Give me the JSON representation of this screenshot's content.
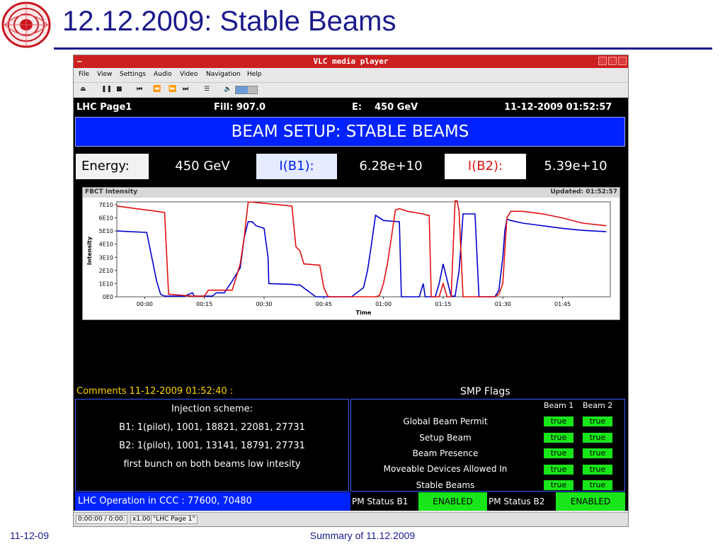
{
  "slide": {
    "title": "12.12.2009: Stable Beams",
    "footer_date": "11-12-09",
    "footer_center": "Summary of 11.12.2009"
  },
  "vlc": {
    "title": "VLC media player",
    "menu": [
      "File",
      "View",
      "Settings",
      "Audio",
      "Video",
      "Navigation",
      "Help"
    ],
    "toolbar_icons": [
      "eject-icon",
      "pause-icon",
      "stop-icon",
      "skip-back-icon",
      "rewind-icon",
      "fast-forward-icon",
      "skip-forward-icon",
      "playlist-icon",
      "volume-icon"
    ],
    "volume_level": 0.55,
    "status": {
      "time": "0:00:00 / 0:00:",
      "speed": "x1.00",
      "media": "\"LHC Page 1\""
    }
  },
  "lhc": {
    "page": "LHC Page1",
    "fill": "Fill: 907.0",
    "energy_label": "E:",
    "energy_value": "450 GeV",
    "datetime": "11-12-2009 01:52:57",
    "banner": "BEAM SETUP: STABLE BEAMS",
    "values": {
      "energy_label": "Energy:",
      "energy": "450 GeV",
      "ib1_label": "I(B1):",
      "ib1": "6.28e+10",
      "ib2_label": "I(B2):",
      "ib2": "5.39e+10"
    },
    "comments_label": "Comments 11-12-2009 01:52:40 :",
    "comments": [
      "Injection scheme:",
      "B1: 1(pilot), 1001, 18821, 22081, 27731",
      "B2: 1(pilot), 1001, 13141, 18791, 27731",
      "first bunch on both beams low intesity"
    ],
    "smp_label": "SMP Flags",
    "smp_columns": [
      "Beam 1",
      "Beam 2"
    ],
    "smp_flags": [
      {
        "name": "Global Beam Permit",
        "b1": "true",
        "b2": "true"
      },
      {
        "name": "Setup Beam",
        "b1": "true",
        "b2": "true"
      },
      {
        "name": "Beam Presence",
        "b1": "true",
        "b2": "true"
      },
      {
        "name": "Moveable Devices Allowed In",
        "b1": "true",
        "b2": "true"
      },
      {
        "name": "Stable Beams",
        "b1": "true",
        "b2": "true"
      }
    ],
    "operations": "LHC Operation in CCC : 77600, 70480",
    "pm_b1_label": "PM Status B1",
    "pm_b1": "ENABLED",
    "pm_b2_label": "PM Status B2",
    "pm_b2": "ENABLED",
    "colors": {
      "b1": "#0000cc",
      "b2": "#e01010",
      "banner": "#0022ff",
      "flag": "#19e619"
    }
  },
  "chart_data": {
    "type": "line",
    "title": "FBCT Intensity",
    "updated": "Updated: 01:52:57",
    "xlabel": "Time",
    "ylabel": "Intensity",
    "x_ticks": [
      "00:00",
      "00:15",
      "00:30",
      "00:45",
      "01:00",
      "01:15",
      "01:30",
      "01:45"
    ],
    "y_ticks": [
      "0E0",
      "1E10",
      "2E10",
      "3E10",
      "4E10",
      "5E10",
      "6E10",
      "7E10"
    ],
    "xlim": [
      -7,
      117
    ],
    "ylim": [
      0,
      7
    ],
    "series": [
      {
        "color": "#0000cc",
        "x": [
          -7,
          0,
          0.5,
          3,
          4,
          5,
          10,
          12,
          12.5,
          17,
          18,
          20,
          22,
          24,
          25,
          26,
          27,
          28,
          30,
          31,
          31.2,
          37,
          38,
          39,
          43,
          47,
          52,
          55,
          56,
          57,
          58,
          59,
          60,
          64,
          64.5,
          67,
          68,
          69,
          70,
          70.5,
          73,
          74,
          75,
          77,
          78,
          79,
          79.5,
          80,
          81,
          82,
          83,
          84,
          84.5,
          87,
          88,
          89,
          90,
          90.5,
          91,
          92,
          95,
          100,
          105,
          110,
          116
        ],
        "y": [
          5,
          4.9,
          4.9,
          1.2,
          0.2,
          0.05,
          0.05,
          0.3,
          0.05,
          0.05,
          0.3,
          0.3,
          1.2,
          2.2,
          4.5,
          5.7,
          5.7,
          5.4,
          5.2,
          3.0,
          1.0,
          0.95,
          0.9,
          0.9,
          0,
          0,
          0,
          0.7,
          2.0,
          4.0,
          6.2,
          6.0,
          5.8,
          5.7,
          0,
          0,
          0,
          0,
          1.0,
          0,
          0,
          1.0,
          2.5,
          0.05,
          0.05,
          2.0,
          4.0,
          6.3,
          6.3,
          6.3,
          6.3,
          0,
          0,
          0,
          0,
          0.5,
          3.0,
          5.0,
          5.9,
          5.8,
          5.6,
          5.4,
          5.2,
          5.05,
          4.95
        ]
      },
      {
        "color": "#e01010",
        "x": [
          -7,
          3,
          5,
          6,
          12,
          15,
          16,
          20,
          22,
          24,
          25,
          26,
          27,
          37,
          38,
          39,
          40,
          44,
          45,
          46,
          46.5,
          58,
          59,
          60,
          61,
          62,
          63,
          64,
          65,
          66,
          70,
          71,
          71.5,
          72,
          73,
          74,
          75,
          76,
          77,
          78,
          78.5,
          79,
          80,
          83,
          84,
          84.5,
          88,
          89,
          90,
          90.5,
          91,
          92,
          95,
          100,
          105,
          110,
          116
        ],
        "y": [
          6.9,
          6.5,
          6.4,
          0.2,
          0.05,
          0.05,
          0.5,
          0.5,
          0.5,
          2.5,
          4.5,
          7.2,
          7.2,
          6.9,
          3.8,
          3.5,
          2.5,
          2.4,
          0.7,
          0.05,
          0,
          0,
          0.1,
          1.0,
          2.5,
          4.5,
          6.6,
          6.7,
          6.6,
          6.5,
          6.3,
          6.2,
          6.2,
          0,
          0,
          0,
          1.0,
          0,
          0,
          7.3,
          7.3,
          6.5,
          0,
          0,
          0,
          0,
          0,
          0.2,
          1.0,
          3.5,
          6.0,
          6.5,
          6.5,
          6.3,
          6.0,
          5.6,
          5.4
        ]
      }
    ],
    "grid": false
  }
}
